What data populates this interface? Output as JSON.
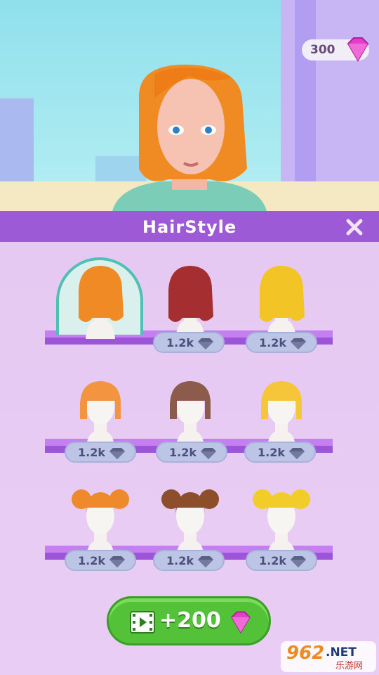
{
  "currency": {
    "amount": "300",
    "icon": "gem-icon"
  },
  "header": {
    "title": "HairStyle",
    "close_icon": "close-icon"
  },
  "hairstyles": [
    {
      "color": "#ef8a24",
      "style": "bob",
      "selected": true
    },
    {
      "color": "#a52f30",
      "style": "bob",
      "price": "1.2k"
    },
    {
      "color": "#f2c426",
      "style": "bob",
      "price": "1.2k"
    },
    {
      "color": "#f39440",
      "style": "short",
      "price": "1.2k"
    },
    {
      "color": "#8d5b4b",
      "style": "short",
      "price": "1.2k"
    },
    {
      "color": "#f5c53a",
      "style": "short",
      "price": "1.2k"
    },
    {
      "color": "#ee8a2c",
      "style": "buns",
      "price": "1.2k"
    },
    {
      "color": "#8c4e2b",
      "style": "buns",
      "price": "1.2k"
    },
    {
      "color": "#f2cd2a",
      "style": "buns",
      "price": "1.2k"
    }
  ],
  "reward_button": {
    "label": "+200",
    "icon": "video-icon",
    "gem_icon": "gem-icon"
  },
  "watermark": {
    "number": "962",
    "suffix": ".NET",
    "site": "乐游网"
  },
  "colors": {
    "accent": "#9c5ad7",
    "button": "#53c238",
    "gem": "#e23ec8"
  }
}
